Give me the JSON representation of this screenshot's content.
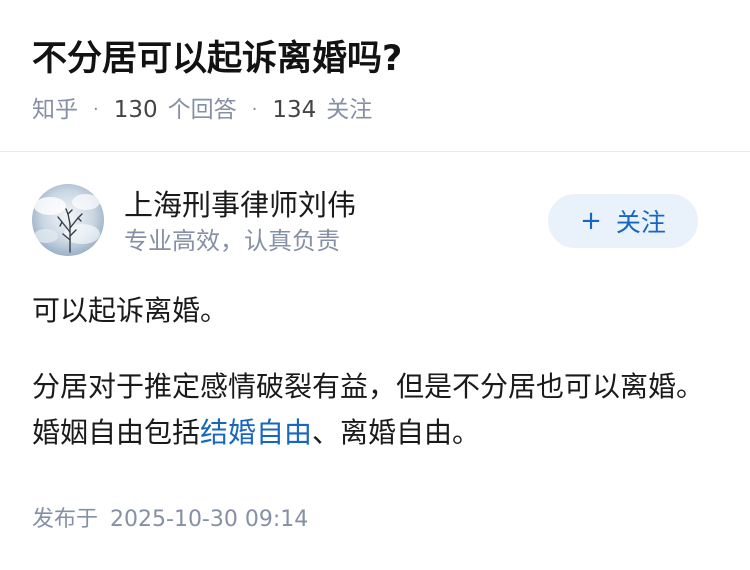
{
  "question": {
    "title": "不分居可以起诉离婚吗?",
    "source": "知乎",
    "answer_count": "130",
    "answer_label": "个回答",
    "follower_count": "134",
    "follower_label": "关注"
  },
  "author": {
    "name": "上海刑事律师刘伟",
    "bio": "专业高效，认真负责",
    "follow_label": "关注",
    "avatar_icon": "tree-in-clouds-avatar"
  },
  "answer": {
    "paragraph1": "可以起诉离婚。",
    "paragraph2_before": "分居对于推定感情破裂有益，但是不分居也可以离婚。婚姻自由包括",
    "paragraph2_link": "结婚自由",
    "paragraph2_after": "、离婚自由。"
  },
  "publish": {
    "label": "发布于",
    "date": "2025-10-30 09:14"
  },
  "colors": {
    "accent": "#1767c1",
    "muted": "#8590a6",
    "button_bg": "#e9f1fb"
  }
}
